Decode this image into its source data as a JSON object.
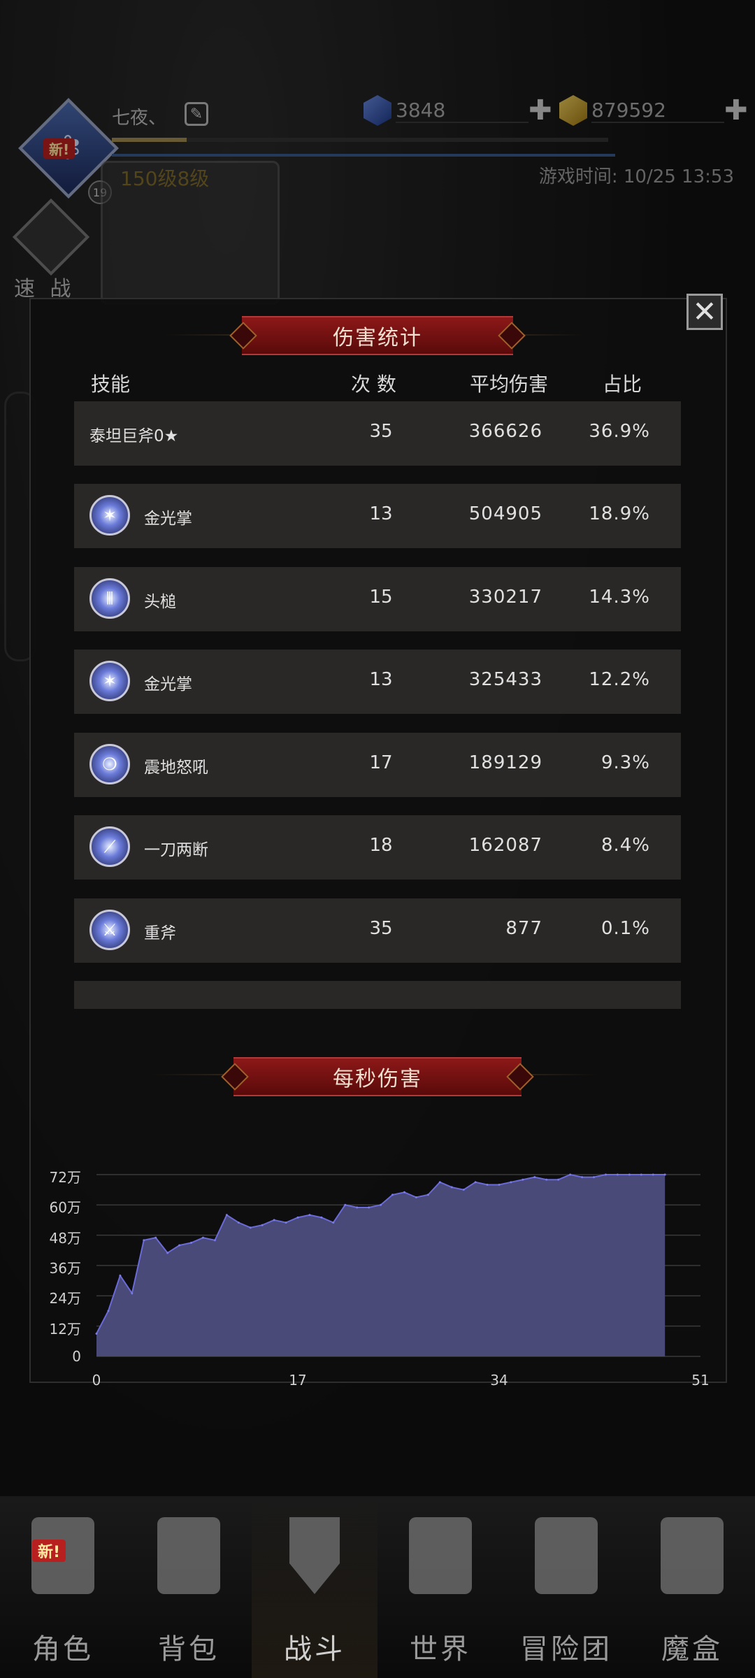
{
  "header": {
    "username": "七夜、",
    "new_badge": "新!",
    "level_badge": "19",
    "level_text": "150级8级",
    "gems": "3848",
    "gold": "879592",
    "plus": "✚",
    "game_time": "游戏时间: 10/25 13:53",
    "xp_progress": 0.15,
    "quick_battle": "速 战"
  },
  "dialog": {
    "title": "伤害统计",
    "close": "✕",
    "headers": {
      "skill": "技能",
      "count": "次 数",
      "avg": "平均伤害",
      "pct": "占比"
    },
    "rows": [
      {
        "name": "泰坦巨斧0★",
        "count": "35",
        "avg": "366626",
        "pct": "36.9%"
      },
      {
        "name": "金光掌",
        "count": "13",
        "avg": "504905",
        "pct": "18.9%",
        "icon": "burst-icon"
      },
      {
        "name": "头槌",
        "count": "15",
        "avg": "330217",
        "pct": "14.3%",
        "icon": "claw-icon"
      },
      {
        "name": "金光掌",
        "count": "13",
        "avg": "325433",
        "pct": "12.2%",
        "icon": "burst-icon"
      },
      {
        "name": "震地怒吼",
        "count": "17",
        "avg": "189129",
        "pct": "9.3%",
        "icon": "roar-icon"
      },
      {
        "name": "一刀两断",
        "count": "18",
        "avg": "162087",
        "pct": "8.4%",
        "icon": "slash-icon"
      },
      {
        "name": "重斧",
        "count": "35",
        "avg": "877",
        "pct": "0.1%",
        "icon": "axe-icon"
      }
    ],
    "dps_title": "每秒伤害"
  },
  "chart_data": {
    "type": "area",
    "title": "每秒伤害",
    "xlabel": "",
    "ylabel": "",
    "ylim": [
      0,
      720000
    ],
    "xlim": [
      0,
      51
    ],
    "y_ticks": [
      "0",
      "12万",
      "24万",
      "36万",
      "48万",
      "60万",
      "72万"
    ],
    "x_ticks": [
      "0",
      "17",
      "34",
      "51"
    ],
    "grid": true,
    "color": "#4a4a78",
    "x": [
      0,
      1,
      2,
      3,
      4,
      5,
      6,
      7,
      8,
      9,
      10,
      11,
      12,
      13,
      14,
      15,
      16,
      17,
      18,
      19,
      20,
      21,
      22,
      23,
      24,
      25,
      26,
      27,
      28,
      29,
      30,
      31,
      32,
      33,
      34,
      35,
      36,
      37,
      38,
      39,
      40,
      41,
      42,
      43,
      44,
      45,
      46,
      47,
      48
    ],
    "values": [
      90000,
      180000,
      320000,
      250000,
      460000,
      470000,
      410000,
      440000,
      450000,
      470000,
      460000,
      560000,
      530000,
      510000,
      520000,
      540000,
      530000,
      550000,
      560000,
      550000,
      530000,
      600000,
      590000,
      590000,
      600000,
      640000,
      650000,
      630000,
      640000,
      690000,
      670000,
      660000,
      690000,
      680000,
      680000,
      690000,
      700000,
      710000,
      700000,
      700000,
      720000,
      710000,
      710000,
      720000,
      720000,
      720000,
      720000,
      720000,
      720000
    ]
  },
  "nav": {
    "items": [
      {
        "label": "角色",
        "icon": "helmet-icon",
        "new": "新!"
      },
      {
        "label": "背包",
        "icon": "backpack-icon"
      },
      {
        "label": "战斗",
        "icon": "shield-sword-icon"
      },
      {
        "label": "世界",
        "icon": "map-icon"
      },
      {
        "label": "冒险团",
        "icon": "castle-icon"
      },
      {
        "label": "魔盒",
        "icon": "cube-icon"
      }
    ]
  }
}
